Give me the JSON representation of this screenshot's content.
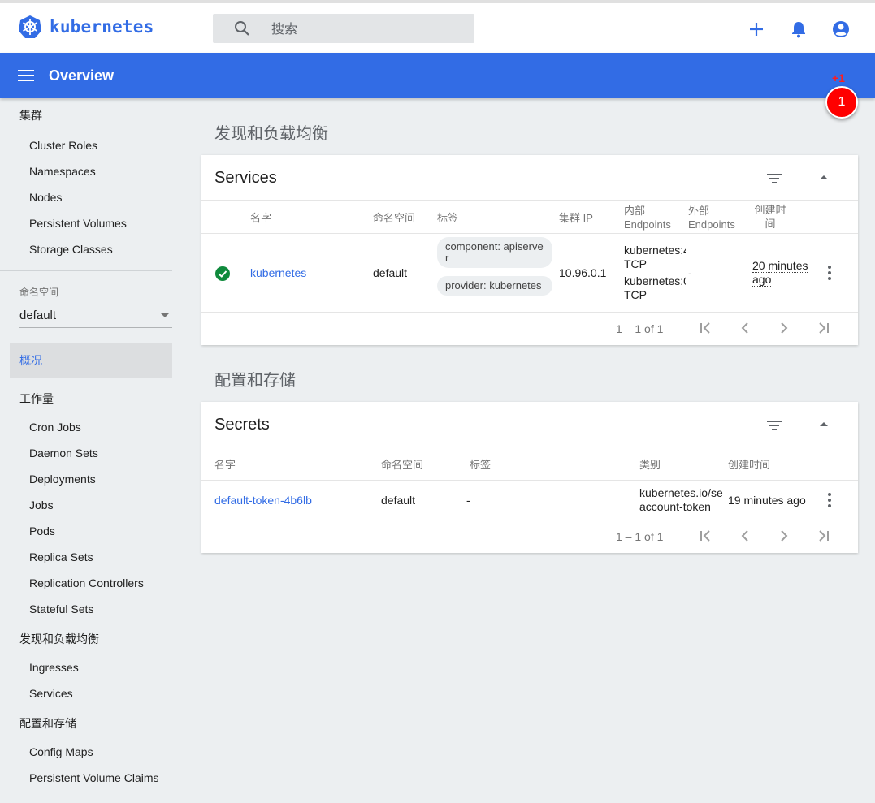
{
  "header": {
    "brand": "kubernetes",
    "search_placeholder": "搜索"
  },
  "titlebar": {
    "title": "Overview",
    "notification_delta": "+1",
    "notification_count": "1"
  },
  "sidebar": {
    "cluster_group": "集群",
    "cluster_items": [
      "Cluster Roles",
      "Namespaces",
      "Nodes",
      "Persistent Volumes",
      "Storage Classes"
    ],
    "namespace_label": "命名空间",
    "namespace_value": "default",
    "overview": "概况",
    "workloads_group": "工作量",
    "workloads_items": [
      "Cron Jobs",
      "Daemon Sets",
      "Deployments",
      "Jobs",
      "Pods",
      "Replica Sets",
      "Replication Controllers",
      "Stateful Sets"
    ],
    "discovery_group": "发现和负载均衡",
    "discovery_items": [
      "Ingresses",
      "Services"
    ],
    "config_group": "配置和存储",
    "config_items": [
      "Config Maps",
      "Persistent Volume Claims"
    ]
  },
  "discovery_section": {
    "title": "发现和负载均衡",
    "services": {
      "title": "Services",
      "columns": {
        "name": "名字",
        "namespace": "命名空间",
        "labels": "标签",
        "cluster_ip": "集群 IP",
        "internal_ep_1": "内部",
        "internal_ep_2": "Endpoints",
        "external_ep_1": "外部",
        "external_ep_2": "Endpoints",
        "created_1": "创建时",
        "created_2": "间"
      },
      "row": {
        "name": "kubernetes",
        "namespace": "default",
        "label_1": "component: apiserver",
        "label_2": "provider: kubernetes",
        "cluster_ip": "10.96.0.1",
        "internal_1a": "kubernetes:4",
        "internal_1b": "TCP",
        "internal_2a": "kubernetes:0",
        "internal_2b": "TCP",
        "external": "-",
        "created": "20 minutes ago"
      },
      "pagination": "1 – 1 of 1"
    }
  },
  "config_section": {
    "title": "配置和存储",
    "secrets": {
      "title": "Secrets",
      "columns": {
        "name": "名字",
        "namespace": "命名空间",
        "labels": "标签",
        "type": "类别",
        "created": "创建时间"
      },
      "row": {
        "name": "default-token-4b6lb",
        "namespace": "default",
        "labels": "-",
        "type_1": "kubernetes.io/se",
        "type_2": "account-token",
        "created": "19 minutes ago"
      },
      "pagination": "1 – 1 of 1"
    }
  },
  "colors": {
    "brand_blue": "#326ce5",
    "success_green": "#0f8a3c",
    "badge_red": "#ff0000"
  }
}
